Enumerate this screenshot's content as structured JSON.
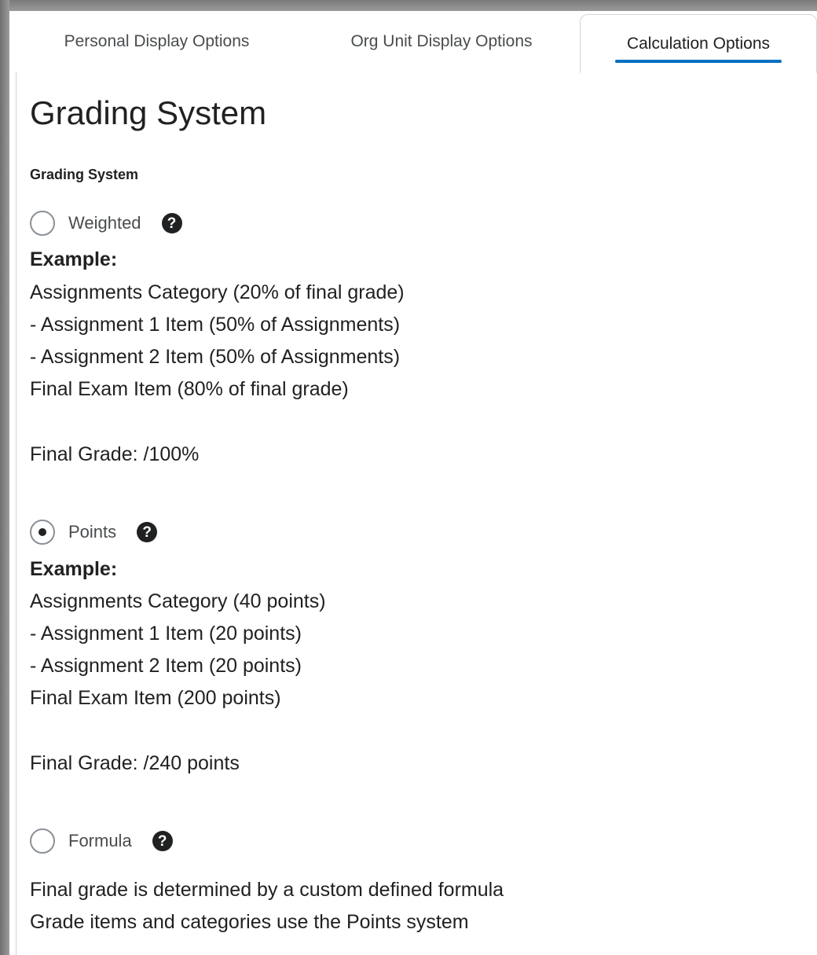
{
  "tabs": [
    {
      "label": "Personal Display Options"
    },
    {
      "label": "Org Unit Display Options"
    },
    {
      "label": "Calculation Options"
    }
  ],
  "page_title": "Grading System",
  "field_label": "Grading System",
  "options": {
    "weighted": {
      "label": "Weighted",
      "example_heading": "Example:",
      "lines": [
        "Assignments Category (20% of final grade)",
        "- Assignment 1 Item (50% of Assignments)",
        "- Assignment 2 Item (50% of Assignments)",
        "Final Exam Item (80% of final grade)"
      ],
      "final_grade": "Final Grade: /100%"
    },
    "points": {
      "label": "Points",
      "example_heading": "Example:",
      "lines": [
        "Assignments Category (40 points)",
        "- Assignment 1 Item (20 points)",
        "- Assignment 2 Item (20 points)",
        "Final Exam Item (200 points)"
      ],
      "final_grade": "Final Grade: /240 points"
    },
    "formula": {
      "label": "Formula",
      "lines": [
        "Final grade is determined by a custom defined formula",
        "Grade items and categories use the Points system"
      ]
    }
  },
  "selected_option": "Points",
  "icons": {
    "help": "help-icon"
  },
  "colors": {
    "accent": "#006fbf",
    "text": "#202122",
    "muted_text": "#494c4e",
    "border": "#cdd5dc"
  }
}
